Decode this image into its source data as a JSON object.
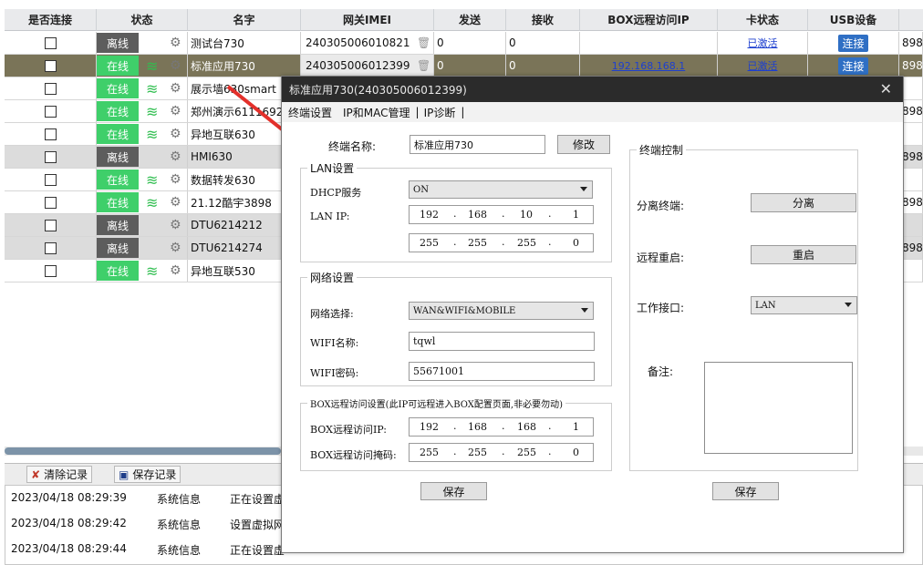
{
  "columns": [
    "是否连接",
    "状态",
    "名字",
    "网关IMEI",
    "发送",
    "接收",
    "BOX远程访问IP",
    "卡状态",
    "USB设备"
  ],
  "rows": [
    {
      "status": "离线",
      "online": false,
      "name": "测试台730",
      "imei": "240305006010821",
      "send": "0",
      "recv": "0",
      "box_ip": "",
      "card": "已激活",
      "usb": "连接",
      "extra": "898"
    },
    {
      "status": "在线",
      "online": true,
      "name": "标准应用730",
      "imei": "240305006012399",
      "send": "0",
      "recv": "0",
      "box_ip": "192.168.168.1",
      "card": "已激活",
      "usb": "连接",
      "extra": "898"
    },
    {
      "status": "在线",
      "online": true,
      "name": "展示墙630smart",
      "imei": "",
      "send": "",
      "recv": "",
      "box_ip": "",
      "card": "",
      "usb": "",
      "extra": ""
    },
    {
      "status": "在线",
      "online": true,
      "name": "郑州演示6111692",
      "imei": "",
      "send": "",
      "recv": "",
      "box_ip": "",
      "card": "",
      "usb": "",
      "extra": "898"
    },
    {
      "status": "在线",
      "online": true,
      "name": "异地互联630",
      "imei": "",
      "send": "",
      "recv": "",
      "box_ip": "",
      "card": "",
      "usb": "",
      "extra": ""
    },
    {
      "status": "离线",
      "online": false,
      "name": "HMI630",
      "imei": "",
      "send": "",
      "recv": "",
      "box_ip": "",
      "card": "",
      "usb": "",
      "extra": "898"
    },
    {
      "status": "在线",
      "online": true,
      "name": "数据转发630",
      "imei": "",
      "send": "",
      "recv": "",
      "box_ip": "",
      "card": "",
      "usb": "",
      "extra": ""
    },
    {
      "status": "在线",
      "online": true,
      "name": "21.12酷宇3898",
      "imei": "",
      "send": "",
      "recv": "",
      "box_ip": "",
      "card": "",
      "usb": "",
      "extra": "898"
    },
    {
      "status": "离线",
      "online": false,
      "name": "DTU6214212",
      "imei": "",
      "send": "",
      "recv": "",
      "box_ip": "",
      "card": "",
      "usb": "",
      "extra": ""
    },
    {
      "status": "离线",
      "online": false,
      "name": "DTU6214274",
      "imei": "",
      "send": "",
      "recv": "",
      "box_ip": "",
      "card": "",
      "usb": "",
      "extra": "898"
    },
    {
      "status": "在线",
      "online": true,
      "name": "异地互联530",
      "imei": "",
      "send": "",
      "recv": "",
      "box_ip": "",
      "card": "",
      "usb": "",
      "extra": ""
    }
  ],
  "log_toolbar": {
    "clear": "清除记录",
    "save": "保存记录"
  },
  "log": [
    {
      "time": "2023/04/18 08:29:39",
      "type": "系统信息",
      "msg": "正在设置虚"
    },
    {
      "time": "2023/04/18 08:29:42",
      "type": "系统信息",
      "msg": "设置虚拟网"
    },
    {
      "time": "2023/04/18 08:29:44",
      "type": "系统信息",
      "msg": "正在设置虚"
    }
  ],
  "dialog": {
    "title": "标准应用730(240305006012399)",
    "tabs": [
      "终端设置",
      "IP和MAC管理",
      "IP诊断"
    ],
    "name_label": "终端名称:",
    "name_value": "标准应用730",
    "modify": "修改",
    "lan": {
      "title": "LAN设置",
      "dhcp_label": "DHCP服务",
      "dhcp_value": "ON",
      "ip_label": "LAN IP:",
      "ip": [
        "192",
        "168",
        "10",
        "1"
      ],
      "mask": [
        "255",
        "255",
        "255",
        "0"
      ]
    },
    "net": {
      "title": "网络设置",
      "select_label": "网络选择:",
      "select_value": "WAN&WIFI&MOBILE",
      "wifi_name_label": "WIFI名称:",
      "wifi_name": "tqwl",
      "wifi_pwd_label": "WIFI密码:",
      "wifi_pwd": "55671001"
    },
    "box": {
      "title": "BOX远程访问设置(此IP可远程进入BOX配置页面,非必要勿动)",
      "ip_label": "BOX远程访问IP:",
      "ip": [
        "192",
        "168",
        "168",
        "1"
      ],
      "mask_label": "BOX远程访问掩码:",
      "mask": [
        "255",
        "255",
        "255",
        "0"
      ]
    },
    "save_left": "保存",
    "ctrl": {
      "title": "终端控制",
      "detach_label": "分离终端:",
      "detach_btn": "分离",
      "reboot_label": "远程重启:",
      "reboot_btn": "重启",
      "iface_label": "工作接口:",
      "iface_value": "LAN",
      "note_label": "备注:"
    },
    "save_right": "保存"
  }
}
